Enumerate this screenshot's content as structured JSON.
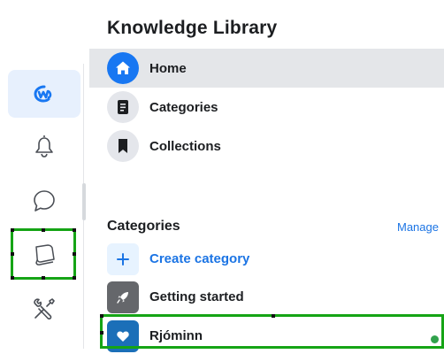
{
  "library": {
    "title": "Knowledge Library"
  },
  "nav": [
    {
      "label": "Home",
      "icon": "home-icon",
      "active": true
    },
    {
      "label": "Categories",
      "icon": "document-icon",
      "active": false
    },
    {
      "label": "Collections",
      "icon": "bookmark-icon",
      "active": false
    }
  ],
  "categories_section": {
    "title": "Categories",
    "manage_label": "Manage",
    "create_label": "Create category",
    "items": [
      {
        "label": "Getting started",
        "icon": "rocket-icon",
        "color": "#65676b"
      },
      {
        "label": "Rjóminn",
        "icon": "heart-icon",
        "color": "#1b6fb8",
        "status": "online",
        "status_color": "#31a24c"
      }
    ]
  },
  "rail": [
    {
      "icon": "workplace-logo-icon",
      "active": true
    },
    {
      "icon": "bell-icon",
      "active": false
    },
    {
      "icon": "chat-bubble-icon",
      "active": false
    },
    {
      "icon": "knowledge-library-icon",
      "active": false,
      "highlighted": true
    },
    {
      "icon": "tools-icon",
      "active": false
    }
  ],
  "colors": {
    "accent": "#1877f2",
    "link": "#1b74e4",
    "highlight": "#15a415",
    "active_row": "#e4e6e9"
  }
}
